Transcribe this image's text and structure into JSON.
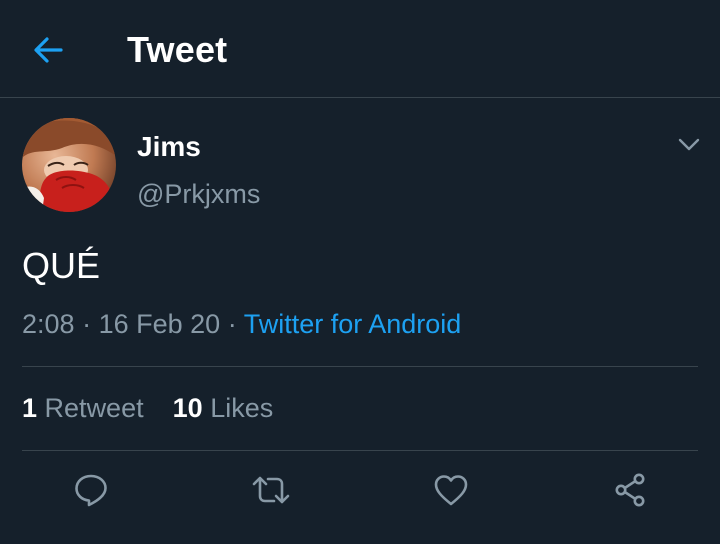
{
  "header": {
    "title": "Tweet",
    "back_icon": "arrow-left-icon"
  },
  "colors": {
    "background": "#15202b",
    "accent": "#1da1f2",
    "secondary_text": "#8899a6",
    "divider": "#38444d"
  },
  "tweet": {
    "author": {
      "display_name": "Jims",
      "handle": "@Prkjxms"
    },
    "text": "QUÉ",
    "time": "2:08",
    "separator": "·",
    "date": "16 Feb 20",
    "source": "Twitter for Android"
  },
  "stats": {
    "retweets_count": "1",
    "retweets_label": "Retweet",
    "likes_count": "10",
    "likes_label": "Likes"
  },
  "actions": [
    {
      "icon": "reply-icon"
    },
    {
      "icon": "retweet-icon"
    },
    {
      "icon": "like-icon"
    },
    {
      "icon": "share-icon"
    }
  ]
}
